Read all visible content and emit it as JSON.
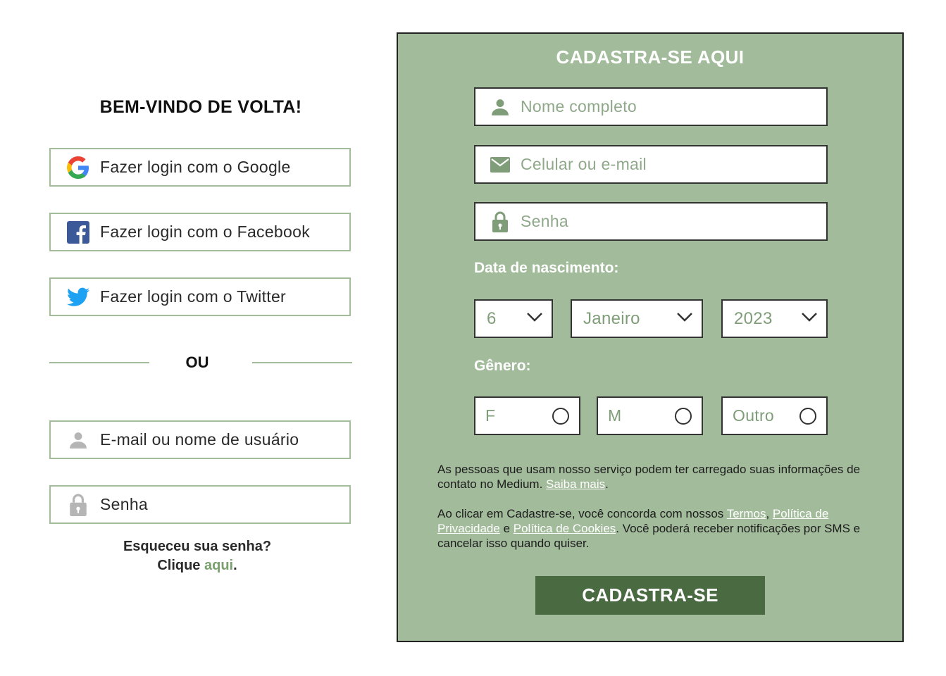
{
  "login": {
    "welcome_title": "BEM-VINDO DE VOLTA!",
    "social_buttons": [
      {
        "label": "Fazer login com o Google",
        "icon": "google-icon"
      },
      {
        "label": "Fazer login com o Facebook",
        "icon": "facebook-icon"
      },
      {
        "label": "Fazer login com o Twitter",
        "icon": "twitter-icon"
      }
    ],
    "separator_text": "OU",
    "username_placeholder": "E-mail ou nome de usuário",
    "password_placeholder": "Senha",
    "forgot_line1": "Esqueceu sua senha?",
    "forgot_prefix": "Clique",
    "forgot_link": "aqui",
    "forgot_suffix": "."
  },
  "signup": {
    "title": "CADASTRA-SE AQUI",
    "name_placeholder": "Nome completo",
    "contact_placeholder": "Celular ou e-mail",
    "password_placeholder": "Senha",
    "birthdate_label": "Data de nascimento:",
    "birth_day": "6",
    "birth_month": "Janeiro",
    "birth_year": "2023",
    "gender_label": "Gênero:",
    "gender_options": [
      "F",
      "M",
      "Outro"
    ],
    "notice": {
      "text": "As pessoas que usam nosso serviço podem ter carregado suas informações de contato no Medium.",
      "link": "Saiba mais",
      "end": "."
    },
    "terms": {
      "prefix": "Ao clicar em Cadastre-se, você concorda com nossos",
      "link_terms": "Termos",
      "comma": ",",
      "link_privacy": "Política de Privacidade",
      "and": "e",
      "link_cookies": "Política de Cookies",
      "suffix": ". Você poderá receber notificações por SMS e cancelar isso quando quiser."
    },
    "submit_label": "CADASTRA-SE"
  },
  "colors": {
    "panel_bg": "#a2bb9b",
    "accent_dark": "#4a6a42",
    "border_light_green": "#a3bd9b",
    "placeholder_green": "#7f9d78"
  }
}
